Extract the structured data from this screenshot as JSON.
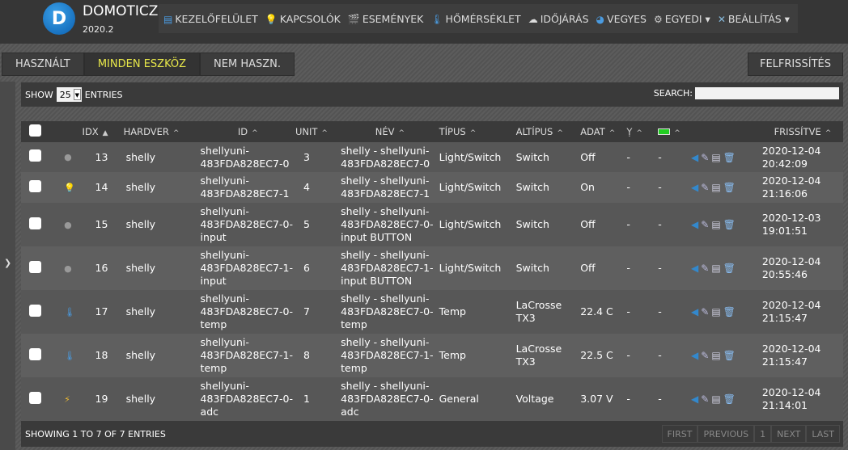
{
  "app": {
    "title": "DOMOTICZ",
    "version": "2020.2"
  },
  "menu": [
    {
      "label": "KEZELŐFELÜLET",
      "icon": "dashboard-icon",
      "glyph": "▤",
      "color": "#4a9be0"
    },
    {
      "label": "KAPCSOLÓK",
      "icon": "lightbulb-icon",
      "glyph": "💡",
      "color": "#ee4"
    },
    {
      "label": "ESEMÉNYEK",
      "icon": "clapperboard-icon",
      "glyph": "🎬",
      "color": "#8bd"
    },
    {
      "label": "HŐMÉRSÉKLET",
      "icon": "thermometer-icon",
      "glyph": "🌡",
      "color": "#4a9be0"
    },
    {
      "label": "IDŐJÁRÁS",
      "icon": "weather-cloud-icon",
      "glyph": "☁",
      "color": "#ddd"
    },
    {
      "label": "VEGYES",
      "icon": "utility-icon",
      "glyph": "◕",
      "color": "#4a9be0"
    },
    {
      "label": "EGYEDI ▾",
      "icon": "gear-icon",
      "glyph": "⚙",
      "color": "#ccc"
    },
    {
      "label": "BEÁLLÍTÁS ▾",
      "icon": "tools-icon",
      "glyph": "✕",
      "color": "#8bd"
    }
  ],
  "tabs": [
    "HASZNÁLT",
    "MINDEN ESZKÖZ",
    "NEM HASZN."
  ],
  "refresh_label": "FELFRISSÍTÉS",
  "controls": {
    "show": "SHOW",
    "page_size": "25",
    "entries": "ENTRIES",
    "search_label": "SEARCH:",
    "search_value": ""
  },
  "columns": [
    "IDX",
    "HARDVER",
    "ID",
    "UNIT",
    "NÉV",
    "TÍPUS",
    "ALTÍPUS",
    "ADAT",
    "",
    "",
    "FRISSÍTVE"
  ],
  "header_icons": {
    "signal": "signal-strength-icon",
    "battery": "battery-icon"
  },
  "rows": [
    {
      "icon": "bulb-off-icon",
      "idx": "13",
      "hw": "shelly",
      "id": "shellyuni-483FDA828EC7-0",
      "unit": "3",
      "name": "shelly - shellyuni-483FDA828EC7-0",
      "type": "Light/Switch",
      "subtype": "Switch",
      "data": "Off",
      "signal": "-",
      "battery": "-",
      "updated": "2020-12-04 20:42:09"
    },
    {
      "icon": "bulb-on-icon",
      "idx": "14",
      "hw": "shelly",
      "id": "shellyuni-483FDA828EC7-1",
      "unit": "4",
      "name": "shelly - shellyuni-483FDA828EC7-1",
      "type": "Light/Switch",
      "subtype": "Switch",
      "data": "On",
      "signal": "-",
      "battery": "-",
      "updated": "2020-12-04 21:16:06"
    },
    {
      "icon": "bulb-off-icon",
      "idx": "15",
      "hw": "shelly",
      "id": "shellyuni-483FDA828EC7-0-input",
      "unit": "5",
      "name": "shelly - shellyuni-483FDA828EC7-0-input BUTTON",
      "type": "Light/Switch",
      "subtype": "Switch",
      "data": "Off",
      "signal": "-",
      "battery": "-",
      "updated": "2020-12-03 19:01:51"
    },
    {
      "icon": "bulb-off-icon",
      "idx": "16",
      "hw": "shelly",
      "id": "shellyuni-483FDA828EC7-1-input",
      "unit": "6",
      "name": "shelly - shellyuni-483FDA828EC7-1-input BUTTON",
      "type": "Light/Switch",
      "subtype": "Switch",
      "data": "Off",
      "signal": "-",
      "battery": "-",
      "updated": "2020-12-04 20:55:46"
    },
    {
      "icon": "thermometer-icon",
      "idx": "17",
      "hw": "shelly",
      "id": "shellyuni-483FDA828EC7-0-temp",
      "unit": "7",
      "name": "shelly - shellyuni-483FDA828EC7-0-temp",
      "type": "Temp",
      "subtype": "LaCrosse TX3",
      "data": "22.4 C",
      "signal": "-",
      "battery": "-",
      "updated": "2020-12-04 21:15:47"
    },
    {
      "icon": "thermometer-icon",
      "idx": "18",
      "hw": "shelly",
      "id": "shellyuni-483FDA828EC7-1-temp",
      "unit": "8",
      "name": "shelly - shellyuni-483FDA828EC7-1-temp",
      "type": "Temp",
      "subtype": "LaCrosse TX3",
      "data": "22.5 C",
      "signal": "-",
      "battery": "-",
      "updated": "2020-12-04 21:15:47"
    },
    {
      "icon": "voltage-icon",
      "idx": "19",
      "hw": "shelly",
      "id": "shellyuni-483FDA828EC7-0-adc",
      "unit": "1",
      "name": "shelly - shellyuni-483FDA828EC7-0-adc",
      "type": "General",
      "subtype": "Voltage",
      "data": "3.07 V",
      "signal": "-",
      "battery": "-",
      "updated": "2020-12-04 21:14:01"
    }
  ],
  "footer": {
    "info": "SHOWING 1 TO 7 OF 7 ENTRIES",
    "pager": [
      "FIRST",
      "PREVIOUS",
      "1",
      "NEXT",
      "LAST"
    ]
  }
}
